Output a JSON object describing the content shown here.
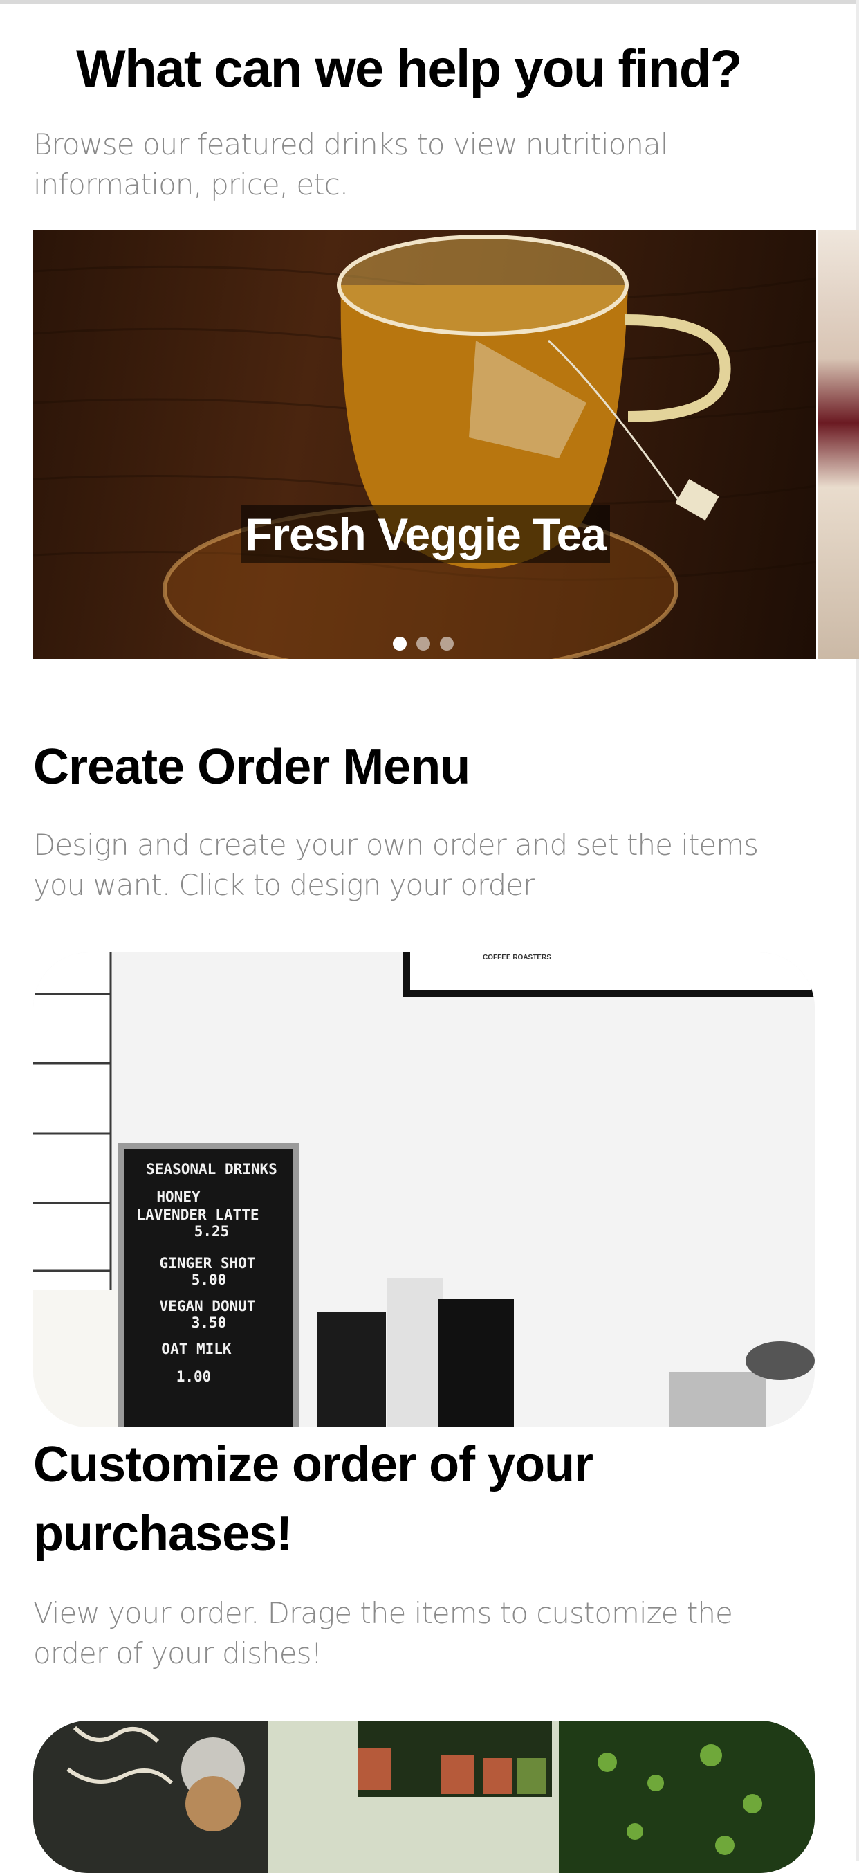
{
  "header": {
    "title": "What can we help you find?",
    "description": "Browse our featured drinks to view nutritional information, price, etc."
  },
  "featured_carousel": {
    "slides": [
      {
        "caption": "Fresh Veggie Tea"
      }
    ],
    "page_indicator": {
      "count": 3,
      "active_index": 0
    }
  },
  "create_order": {
    "title": "Create Order Menu",
    "description": "Design and create your own order and set the items you want. Click to design your order",
    "image": {
      "wall_frame_text": "COFFEE ROASTERS",
      "board_lines": [
        "SEASONAL DRINKS",
        "HONEY",
        "LAVENDER LATTE",
        "5.25",
        "GINGER SHOT",
        "5.00",
        "VEGAN DONUT",
        "3.50",
        "OAT MILK",
        "1.00"
      ]
    }
  },
  "customize_order": {
    "title": "Customize order of your purchases!",
    "description": "View your order. Drage the items to customize the order of your dishes!"
  }
}
